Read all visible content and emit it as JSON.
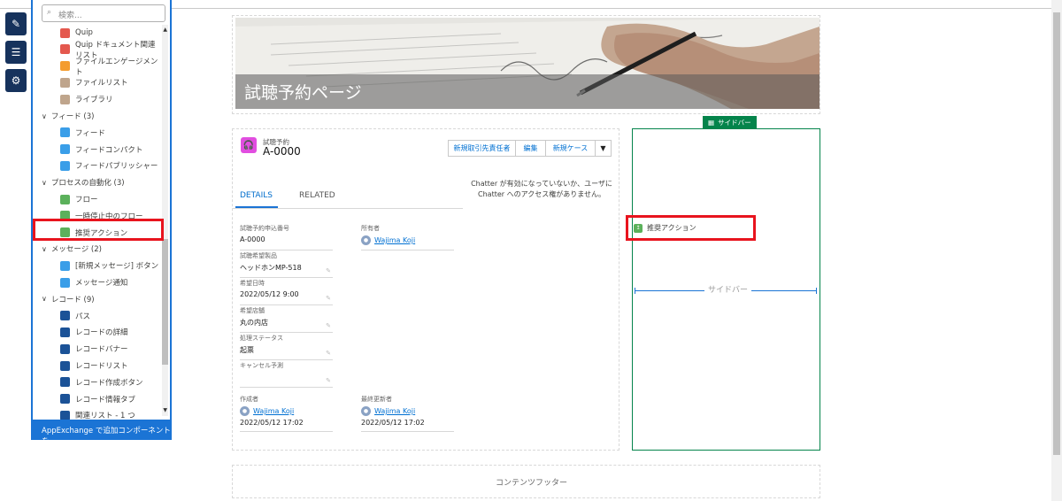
{
  "palette": {
    "search_placeholder": "検索...",
    "items": [
      {
        "kind": "item",
        "label": "Quip",
        "icon": "quip-icon",
        "color": "#e4584e"
      },
      {
        "kind": "item",
        "label": "Quip ドキュメント関連リスト",
        "icon": "quip-icon",
        "color": "#e4584e"
      },
      {
        "kind": "item",
        "label": "ファイルエンゲージメント",
        "icon": "file-engagement-icon",
        "color": "#f49c2f"
      },
      {
        "kind": "item",
        "label": "ファイルリスト",
        "icon": "file-list-icon",
        "color": "#bfa58c"
      },
      {
        "kind": "item",
        "label": "ライブラリ",
        "icon": "library-icon",
        "color": "#bfa58c"
      },
      {
        "kind": "group",
        "label": "フィード (3)"
      },
      {
        "kind": "item",
        "label": "フィード",
        "icon": "feed-icon",
        "color": "#3a9ee8"
      },
      {
        "kind": "item",
        "label": "フィードコンパクト",
        "icon": "feed-compact-icon",
        "color": "#3a9ee8"
      },
      {
        "kind": "item",
        "label": "フィードパブリッシャー",
        "icon": "feed-publisher-icon",
        "color": "#3a9ee8"
      },
      {
        "kind": "group",
        "label": "プロセスの自動化 (3)"
      },
      {
        "kind": "item",
        "label": "フロー",
        "icon": "flow-icon",
        "color": "#5bb15b"
      },
      {
        "kind": "item",
        "label": "一時停止中のフロー",
        "icon": "paused-flow-icon",
        "color": "#5bb15b"
      },
      {
        "kind": "item",
        "label": "推奨アクション",
        "icon": "recommended-action-icon",
        "color": "#5bb15b"
      },
      {
        "kind": "group",
        "label": "メッセージ (2)"
      },
      {
        "kind": "item",
        "label": "[新規メッセージ] ボタン",
        "icon": "message-button-icon",
        "color": "#3a9ee8"
      },
      {
        "kind": "item",
        "label": "メッセージ通知",
        "icon": "message-notification-icon",
        "color": "#3a9ee8"
      },
      {
        "kind": "group",
        "label": "レコード (9)"
      },
      {
        "kind": "item",
        "label": "パス",
        "icon": "path-icon",
        "color": "#1b5297"
      },
      {
        "kind": "item",
        "label": "レコードの詳細",
        "icon": "record-detail-icon",
        "color": "#1b5297"
      },
      {
        "kind": "item",
        "label": "レコードバナー",
        "icon": "record-banner-icon",
        "color": "#1b5297"
      },
      {
        "kind": "item",
        "label": "レコードリスト",
        "icon": "record-list-icon",
        "color": "#1b5297"
      },
      {
        "kind": "item",
        "label": "レコード作成ボタン",
        "icon": "record-create-icon",
        "color": "#1b5297"
      },
      {
        "kind": "item",
        "label": "レコード情報タブ",
        "icon": "record-info-tab-icon",
        "color": "#1b5297"
      },
      {
        "kind": "item",
        "label": "関連リスト - 1 つ",
        "icon": "related-list-icon",
        "color": "#1b5297"
      }
    ],
    "appexchange_label": "AppExchange で追加コンポーネントを..."
  },
  "header": {
    "title": "試聴予約ページ"
  },
  "record": {
    "type_label": "試聴予約",
    "name": "A-0000",
    "buttons": [
      "新規取引先責任者",
      "編集",
      "新規ケース"
    ],
    "tabs": [
      "DETAILS",
      "RELATED"
    ],
    "fields": {
      "app_no_label": "試聴予約申込番号",
      "app_no_value": "A-0000",
      "owner_label": "所有者",
      "owner_value": "Wajima Koji",
      "product_label": "試聴希望製品",
      "product_value": "ヘッドホンMP-518",
      "date_label": "希望日時",
      "date_value": "2022/05/12 9:00",
      "store_label": "希望店舗",
      "store_value": "丸の内店",
      "status_label": "処理ステータス",
      "status_value": "起票",
      "cancel_label": "キャンセル予測",
      "cancel_value": "",
      "created_label": "作成者",
      "created_by": "Wajima Koji",
      "created_at": "2022/05/12 17:02",
      "modified_label": "最終更新者",
      "modified_by": "Wajima Koji",
      "modified_at": "2022/05/12 17:02"
    }
  },
  "chatter_message": "Chatter が有効になっていないか、ユーザに Chatter へのアクセス権がありません。",
  "sidebar": {
    "tag_label": "サイドバー",
    "component_label": "推奨アクション",
    "drop_label": "サイドバー"
  },
  "footer": {
    "label": "コンテンツフッター"
  },
  "colors": {
    "accent": "#1b74d5",
    "highlight": "#e8141e",
    "sidebar": "#04844b"
  }
}
